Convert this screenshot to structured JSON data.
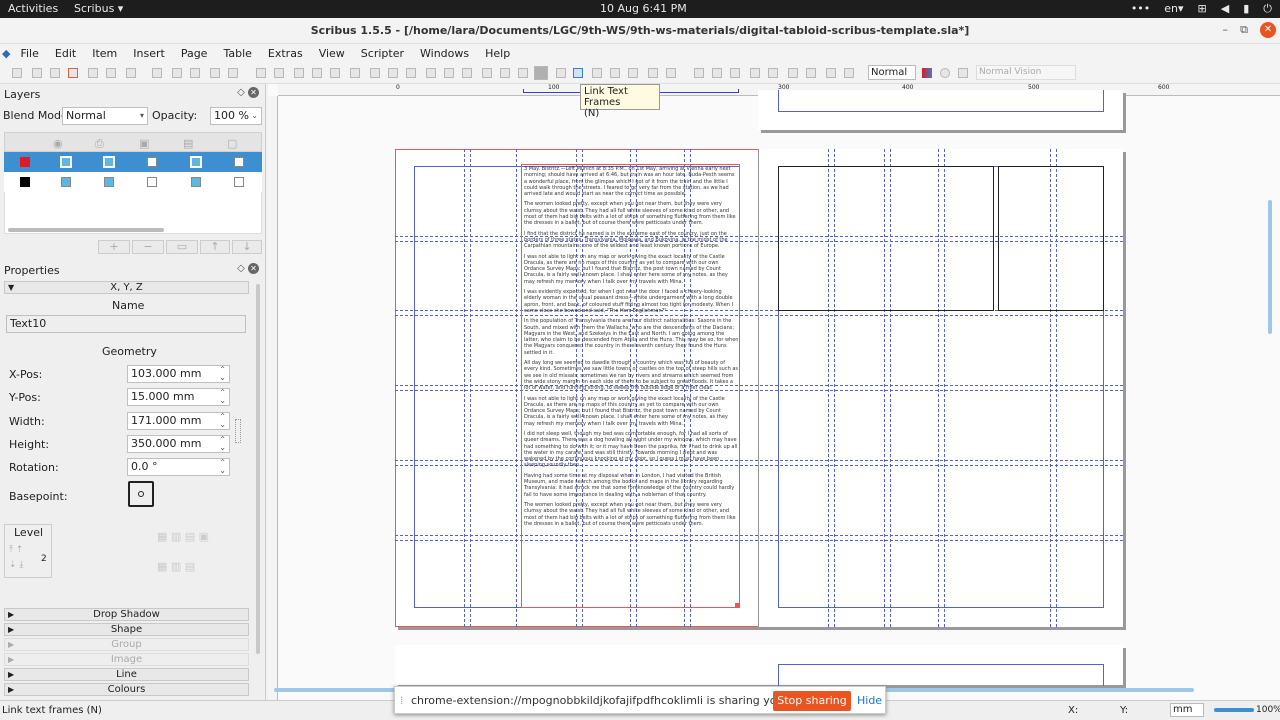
{
  "system_bar": {
    "activities": "Activities",
    "app": "Scribus ▾",
    "clock": "10 Aug   6:41 PM",
    "lang": "en▾"
  },
  "window": {
    "title": "Scribus 1.5.5 - [/home/lara/Documents/LGC/9th-WS/9th-ws-materials/digital-tabloid-scribus-template.sla*]"
  },
  "menu": [
    "File",
    "Edit",
    "Item",
    "Insert",
    "Page",
    "Table",
    "Extras",
    "View",
    "Scripter",
    "Windows",
    "Help"
  ],
  "toolbar": {
    "mode_select": "Normal",
    "vision_select": "Normal Vision"
  },
  "tooltip": {
    "line1": "Link Text Frames",
    "line2": "(N)"
  },
  "layers": {
    "title": "Layers",
    "blend_label": "Blend Mode:",
    "blend_value": "Normal",
    "opacity_label": "Opacity:",
    "opacity_value": "100 %",
    "rows": [
      {
        "color": "#e01b24",
        "selected": true
      },
      {
        "color": "#000000",
        "selected": false
      }
    ]
  },
  "properties": {
    "title": "Properties",
    "section_xyz": "X, Y, Z",
    "name_label": "Name",
    "name_value": "Text10",
    "geometry_label": "Geometry",
    "xpos_label": "X-Pos:",
    "xpos_value": "103.000 mm",
    "ypos_label": "Y-Pos:",
    "ypos_value": "15.000 mm",
    "width_label": "Width:",
    "width_value": "171.000 mm",
    "height_label": "Height:",
    "height_value": "350.000 mm",
    "rotation_label": "Rotation:",
    "rotation_value": "0.0 °",
    "basepoint_label": "Basepoint:",
    "level_label": "Level",
    "level_value": "2",
    "collapsed_sections": [
      "Drop Shadow",
      "Shape",
      "Group",
      "Image",
      "Line",
      "Colours"
    ]
  },
  "document_text": [
    "3 May. Bistritz.—Left Munich at 8:35 P.M., on 1st May, arriving at Vienna early next morning; should have arrived at 6:46, but train was an hour late. Buda-Pesth seems a wonderful place, from the glimpse which I got of it from the train and the little I could walk through the streets. I feared to go very far from the station, as we had arrived late and would start as near the correct time as possible.",
    "The women looked pretty, except when you got near them, but they were very clumsy about the waist. They had all full white sleeves of some kind or other, and most of them had big belts with a lot of strips of something fluttering from them like the dresses in a ballet, but of course there were petticoats under them.",
    "I find that the district he named is in the extreme east of the country, just on the borders of three states, Transylvania, Moldavia, and Bukovina, in the midst of the Carpathian mountains; one of the wildest and least known portions of Europe.",
    "I was not able to light on any map or work giving the exact locality of the Castle Dracula, as there are no maps of this country as yet to compare with our own Ordance Survey Maps; but I found that Bistritz, the post town named by Count Dracula, is a fairly well-known place. I shall enter here some of my notes, as they may refresh my memory when I talk over my travels with Mina.",
    "I was evidently expected, for when I got near the door I faced a cheery-looking elderly woman in the usual peasant dress—white undergarment with a long double apron, front, and back, of coloured stuff fitting almost too tight for modesty. When I came close she bowed and said, \"The Herr Englishman?\"",
    "In the population of Transylvania there are four distinct nationalities: Saxons in the South, and mixed with them the Wallachs, who are the descendants of the Dacians; Magyars in the West, and Szekelys in the East and North. I am going among the latter, who claim to be descended from Attila and the Huns. This may be so, for when the Magyars conquered the country in the eleventh century they found the Huns settled in it.",
    "All day long we seemed to dawdle through a country which was full of beauty of every kind. Sometimes we saw little towns or castles on the top of steep hills such as we see in old missals; sometimes we ran by rivers and streams which seemed from the wide stony margin on each side of them to be subject to great floods. It takes a lot of water, and running strong, to sweep the outside edge of a river clear.",
    "I was not able to light on any map or work giving the exact locality of the Castle Dracula, as there are no maps of this country as yet to compare with our own Ordance Survey Maps; but I found that Bistritz, the post town named by Count Dracula, is a fairly well-known place. I shall enter here some of my notes, as they may refresh my memory when I talk over my travels with Mina.",
    "I did not sleep well, though my bed was comfortable enough, for I had all sorts of queer dreams. There was a dog howling all night under my window, which may have had something to do with it; or it may have been the paprika, for I had to drink up all the water in my carafe, and was still thirsty. Towards morning I slept and was wakened by the continuous knocking at my door, so I guess I must have been sleeping soundly then.",
    "Having had some time at my disposal when in London, I had visited the British Museum, and made search among the books and maps in the library regarding Transylvania; it had struck me that some foreknowledge of the country could hardly fail to have some importance in dealing with a nobleman of that country.",
    "The women looked pretty, except when you got near them, but they were very clumsy about the waist. They had all full white sleeves of some kind or other, and most of them had big belts with a lot of strips of something fluttering from them like the dresses in a ballet, but of course there were petticoats under them."
  ],
  "ruler": {
    "marks": [
      "0",
      "100",
      "200",
      "300",
      "400",
      "500",
      "600"
    ]
  },
  "statusbar": {
    "message": "Link text frames (N)",
    "x_label": "X:",
    "y_label": "Y:",
    "unit": "mm",
    "zoom": "100%"
  },
  "sharebar": {
    "message": "chrome-extension://mpognobbkildjkofajifpdfhcoklimli is sharing your screen.",
    "stop": "Stop sharing",
    "hide": "Hide"
  }
}
